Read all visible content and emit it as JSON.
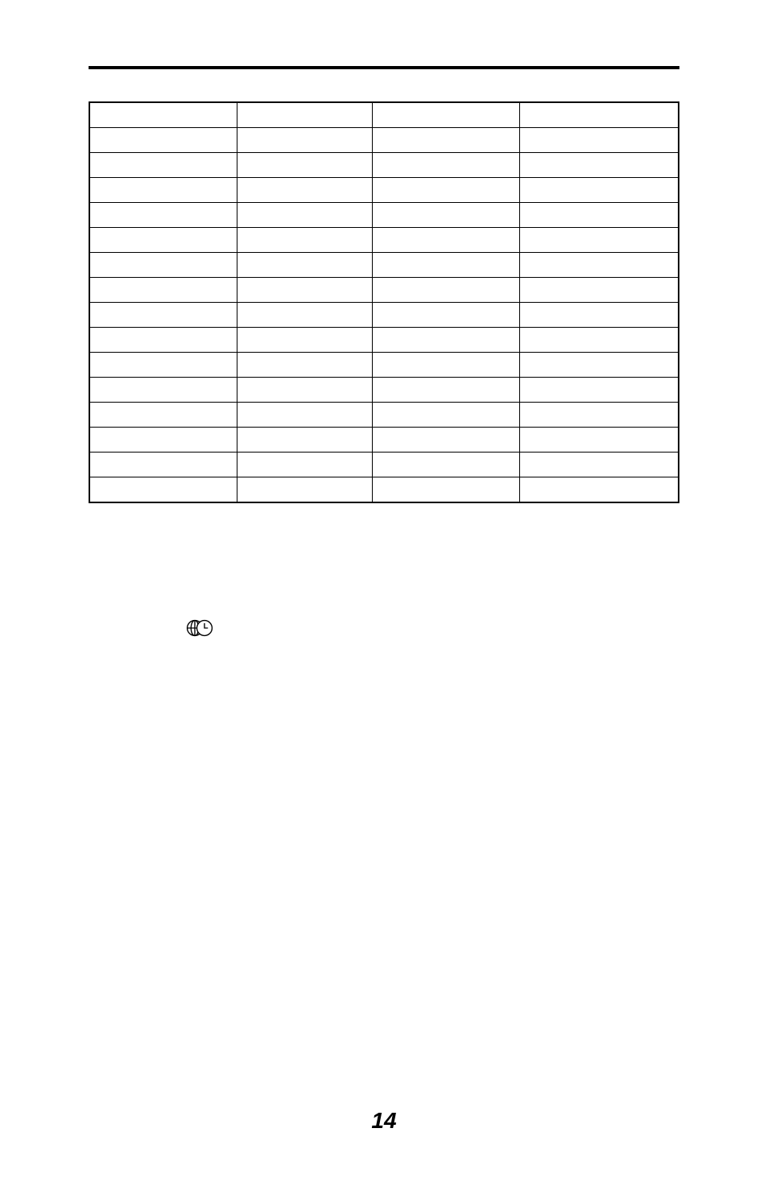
{
  "page_number": "14",
  "table": {
    "columns": 4,
    "rows": 16
  },
  "icon_name": "world-clock-icon"
}
